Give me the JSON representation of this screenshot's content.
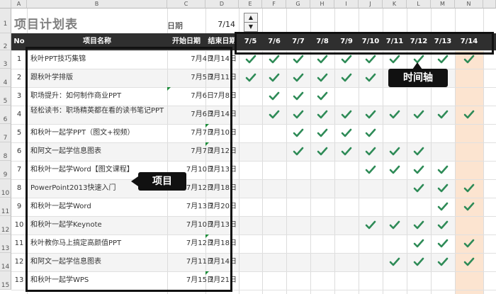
{
  "sheet": {
    "col_letters": [
      "A",
      "B",
      "C",
      "D",
      "E",
      "F",
      "G",
      "H",
      "I",
      "J",
      "K",
      "L",
      "M",
      "N"
    ],
    "row_numbers": [
      "1",
      "2",
      "3",
      "4",
      "5",
      "6",
      "7",
      "8",
      "9",
      "10",
      "11",
      "12",
      "13",
      "14",
      "15"
    ]
  },
  "title": "项目计划表",
  "date_label": "日期",
  "date_value": "7/14",
  "spinner": {
    "up": "▲",
    "down": "▼"
  },
  "table": {
    "headers": {
      "no": "No",
      "name": "项目名称",
      "start": "开始日期",
      "end": "结束日期"
    },
    "date_headers": [
      "7/5",
      "7/6",
      "7/7",
      "7/8",
      "7/9",
      "7/10",
      "7/11",
      "7/12",
      "7/13",
      "7/14"
    ],
    "rows": [
      {
        "no": "1",
        "name": "秋叶PPT技巧集锦",
        "start": "7月4日",
        "end": "7月14日",
        "checks": [
          1,
          1,
          1,
          1,
          1,
          1,
          1,
          1,
          1,
          1
        ]
      },
      {
        "no": "2",
        "name": "跟秋叶学排版",
        "start": "7月5日",
        "end": "7月11日",
        "checks": [
          1,
          1,
          1,
          1,
          1,
          1,
          1,
          0,
          0,
          0
        ]
      },
      {
        "no": "3",
        "name": "职场提升：如何制作商业PPT",
        "start": "7月6日",
        "end": "7月8日",
        "checks": [
          0,
          1,
          1,
          1,
          0,
          0,
          0,
          0,
          0,
          0
        ]
      },
      {
        "no": "4",
        "name": "轻松读书：职场精英都在看的读书笔记PPT",
        "start": "7月6日",
        "end": "7月14日",
        "checks": [
          0,
          1,
          1,
          1,
          1,
          1,
          1,
          1,
          1,
          1
        ]
      },
      {
        "no": "5",
        "name": "和秋叶一起学PPT（图文+视频）",
        "start": "7月7日",
        "end": "7月10日",
        "checks": [
          0,
          0,
          1,
          1,
          1,
          1,
          0,
          0,
          0,
          0
        ]
      },
      {
        "no": "6",
        "name": "和阿文一起学信息图表",
        "start": "7月7日",
        "end": "7月12日",
        "checks": [
          0,
          0,
          1,
          1,
          1,
          1,
          1,
          1,
          0,
          0
        ]
      },
      {
        "no": "7",
        "name": "和秋叶一起学Word【图文课程】",
        "start": "7月10日",
        "end": "7月13日",
        "checks": [
          0,
          0,
          0,
          0,
          0,
          1,
          1,
          1,
          1,
          0
        ]
      },
      {
        "no": "8",
        "name": "PowerPoint2013快速入门",
        "start": "7月12日",
        "end": "7月18日",
        "checks": [
          0,
          0,
          0,
          0,
          0,
          0,
          0,
          1,
          1,
          1
        ]
      },
      {
        "no": "9",
        "name": "和秋叶一起学Word",
        "start": "7月13日",
        "end": "7月20日",
        "checks": [
          0,
          0,
          0,
          0,
          0,
          0,
          0,
          0,
          1,
          1
        ]
      },
      {
        "no": "10",
        "name": "和秋叶一起学Keynote",
        "start": "7月10日",
        "end": "7月13日",
        "checks": [
          0,
          0,
          0,
          0,
          0,
          1,
          1,
          1,
          1,
          0
        ]
      },
      {
        "no": "11",
        "name": "秋叶教你马上搞定高颜值PPT",
        "start": "7月12日",
        "end": "7月18日",
        "checks": [
          0,
          0,
          0,
          0,
          0,
          0,
          0,
          1,
          1,
          1
        ]
      },
      {
        "no": "12",
        "name": "和阿文一起学信息图表",
        "start": "7月11日",
        "end": "7月14日",
        "checks": [
          0,
          0,
          0,
          0,
          0,
          0,
          1,
          1,
          1,
          1
        ]
      },
      {
        "no": "13",
        "name": "和秋叶一起学WPS",
        "start": "7月15日",
        "end": "7月21日",
        "checks": [
          0,
          0,
          0,
          0,
          0,
          0,
          0,
          0,
          0,
          0
        ]
      }
    ]
  },
  "callouts": {
    "timeline": "时间轴",
    "project": "项目"
  },
  "colors": {
    "check": "#2e8b57",
    "highlight_col": "#fce4d0",
    "header_bg": "#2f2f2f"
  }
}
